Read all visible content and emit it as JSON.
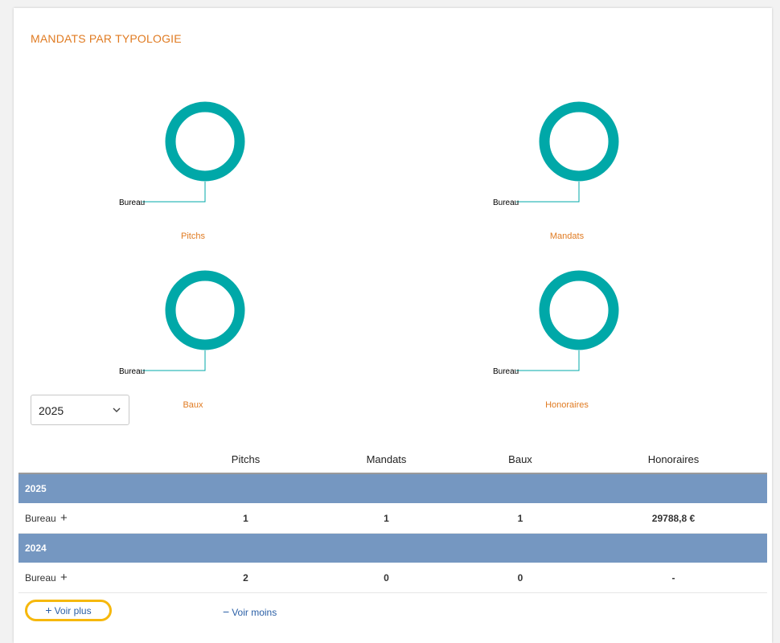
{
  "card": {
    "title": "MANDATS PAR TYPOLOGIE"
  },
  "chart_data": [
    {
      "type": "pie",
      "title": "Pitchs",
      "categories": [
        "Bureau"
      ],
      "values": [
        1
      ],
      "colors": [
        "#00a8a8"
      ]
    },
    {
      "type": "pie",
      "title": "Mandats",
      "categories": [
        "Bureau"
      ],
      "values": [
        1
      ],
      "colors": [
        "#00a8a8"
      ]
    },
    {
      "type": "pie",
      "title": "Baux",
      "categories": [
        "Bureau"
      ],
      "values": [
        1
      ],
      "colors": [
        "#00a8a8"
      ]
    },
    {
      "type": "pie",
      "title": "Honoraires",
      "categories": [
        "Bureau"
      ],
      "values": [
        1
      ],
      "colors": [
        "#00a8a8"
      ]
    }
  ],
  "year_select": {
    "value": "2025",
    "icon": "chevron-down-icon"
  },
  "table": {
    "headers": [
      "",
      "Pitchs",
      "Mandats",
      "Baux",
      "Honoraires"
    ],
    "groups": [
      {
        "year": "2025",
        "rows": [
          {
            "label": "Bureau",
            "expand": "+",
            "pitchs": "1",
            "mandats": "1",
            "baux": "1",
            "honoraires": "29788,8 €"
          }
        ]
      },
      {
        "year": "2024",
        "rows": [
          {
            "label": "Bureau",
            "expand": "+",
            "pitchs": "2",
            "mandats": "0",
            "baux": "0",
            "honoraires": "-"
          }
        ]
      }
    ]
  },
  "buttons": {
    "voir_plus": "Voir plus",
    "voir_moins": "Voir moins",
    "plus_symbol": "+",
    "minus_symbol": "−"
  },
  "colors": {
    "accent": "#e07b22",
    "donut": "#00a8a8",
    "header_row": "#7597c1",
    "link": "#2a5fa6",
    "highlight": "#f6b80d"
  }
}
